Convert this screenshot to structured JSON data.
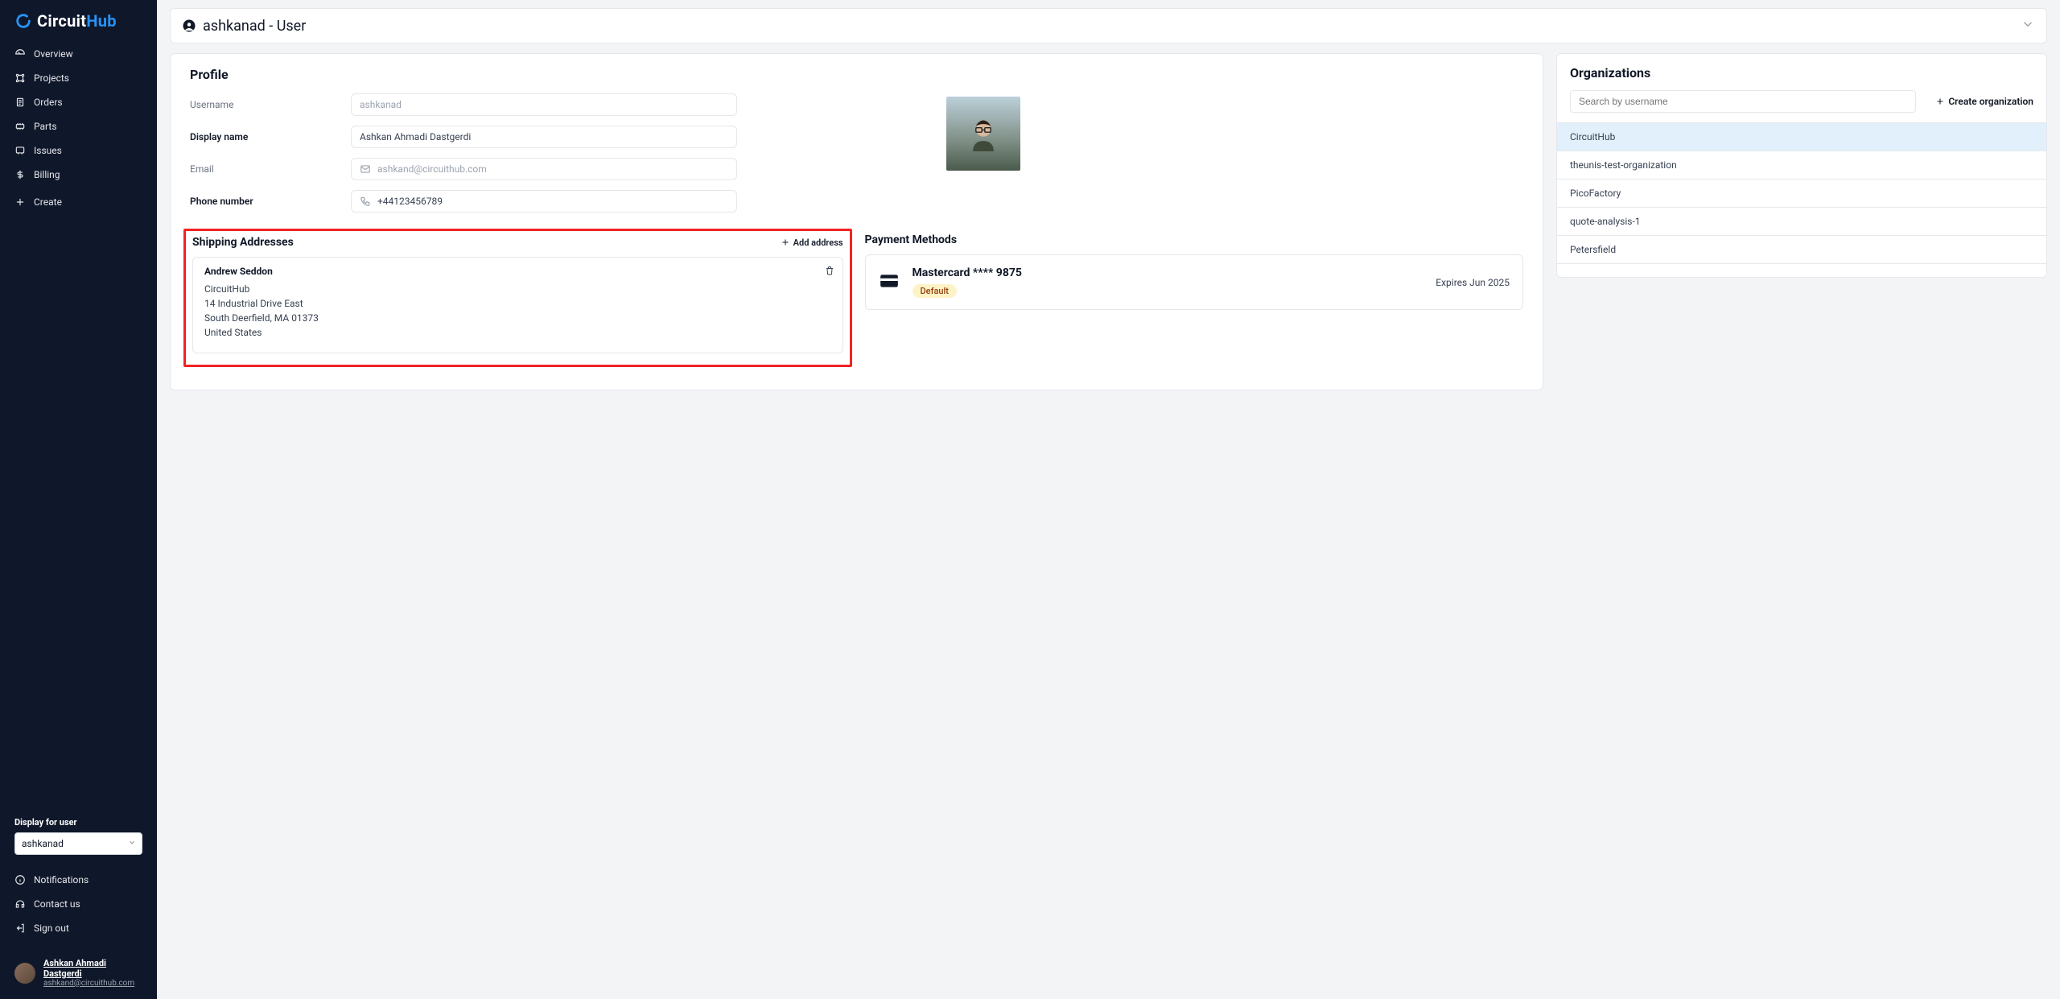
{
  "brand": {
    "name1": "Circuit",
    "name2": "Hub"
  },
  "sidebar": {
    "items": [
      {
        "label": "Overview"
      },
      {
        "label": "Projects"
      },
      {
        "label": "Orders"
      },
      {
        "label": "Parts"
      },
      {
        "label": "Issues"
      },
      {
        "label": "Billing"
      }
    ],
    "create_label": "Create",
    "display_for_label": "Display for user",
    "display_for_value": "ashkanad",
    "bottom_links": {
      "notifications": "Notifications",
      "contact": "Contact us",
      "signout": "Sign out"
    },
    "user": {
      "name": "Ashkan Ahmadi Dastgerdi",
      "email": "ashkand@circuithub.com"
    }
  },
  "header": {
    "title": "ashkanad - User"
  },
  "profile": {
    "title": "Profile",
    "labels": {
      "username": "Username",
      "display": "Display name",
      "email": "Email",
      "phone": "Phone number"
    },
    "values": {
      "username": "ashkanad",
      "display": "Ashkan Ahmadi Dastgerdi",
      "email": "ashkand@circuithub.com",
      "phone": "+44123456789"
    }
  },
  "shipping": {
    "title": "Shipping Addresses",
    "add_label": "Add address",
    "address": {
      "name": "Andrew Seddon",
      "org": "CircuitHub",
      "street": "14 Industrial Drive East",
      "city": "South Deerfield, MA 01373",
      "country": "United States"
    }
  },
  "payment": {
    "title": "Payment Methods",
    "card_title": "Mastercard **** 9875",
    "expires": "Expires Jun 2025",
    "default_badge": "Default"
  },
  "orgs": {
    "title": "Organizations",
    "search_placeholder": "Search by username",
    "create_label": "Create organization",
    "items": [
      "CircuitHub",
      "theunis-test-organization",
      "PicoFactory",
      "quote-analysis-1",
      "Petersfield"
    ]
  }
}
